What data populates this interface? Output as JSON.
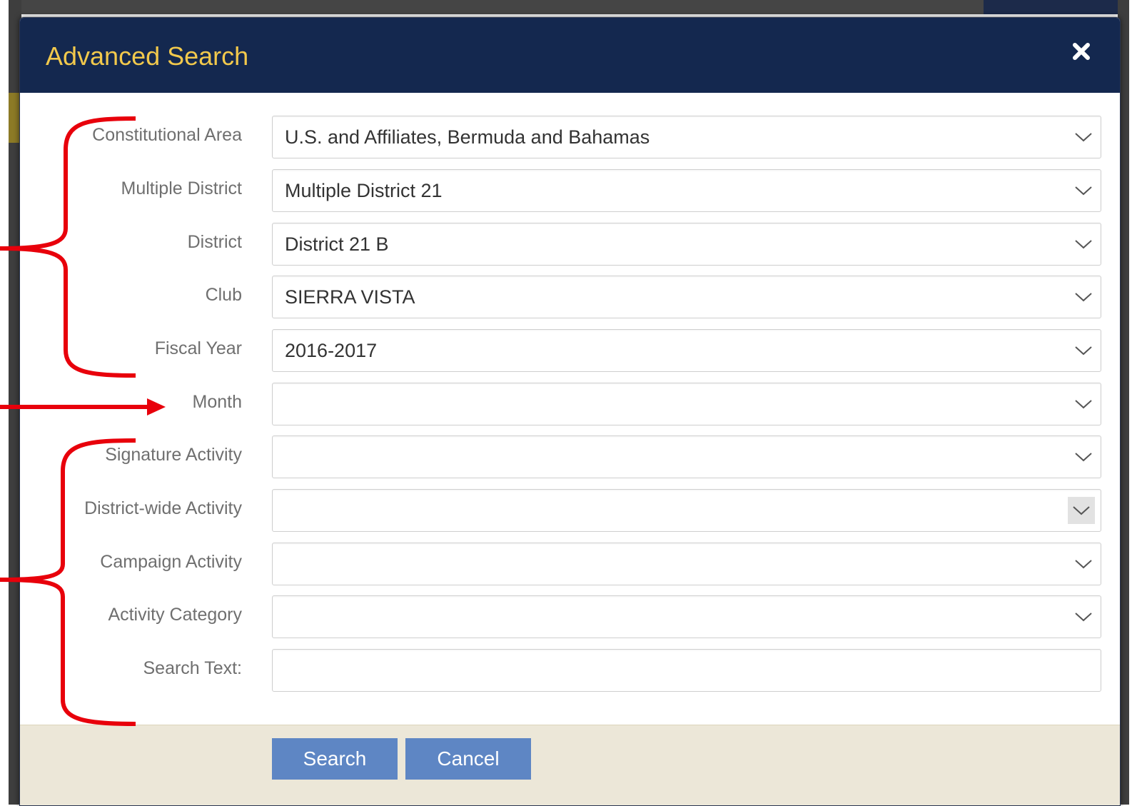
{
  "modal": {
    "title": "Advanced Search",
    "close_icon": "close-x-icon"
  },
  "fields": {
    "constitutional_area": {
      "label": "Constitutional Area",
      "value": "U.S. and Affiliates, Bermuda and Bahamas"
    },
    "multiple_district": {
      "label": "Multiple District",
      "value": "Multiple District 21"
    },
    "district": {
      "label": "District",
      "value": "District 21 B"
    },
    "club": {
      "label": "Club",
      "value": "SIERRA VISTA"
    },
    "fiscal_year": {
      "label": "Fiscal Year",
      "value": "2016-2017"
    },
    "month": {
      "label": "Month",
      "value": ""
    },
    "signature_activity": {
      "label": "Signature Activity",
      "value": ""
    },
    "district_wide_activity": {
      "label": "District-wide Activity",
      "value": ""
    },
    "campaign_activity": {
      "label": "Campaign Activity",
      "value": ""
    },
    "activity_category": {
      "label": "Activity Category",
      "value": ""
    },
    "search_text": {
      "label": "Search Text:",
      "value": ""
    }
  },
  "footer": {
    "search_label": "Search",
    "cancel_label": "Cancel"
  },
  "colors": {
    "header_bg": "#14284f",
    "title_color": "#f2c94c",
    "button_bg": "#5e86c4",
    "footer_bg": "#ece7d8",
    "annotation_red": "#e8000b"
  }
}
